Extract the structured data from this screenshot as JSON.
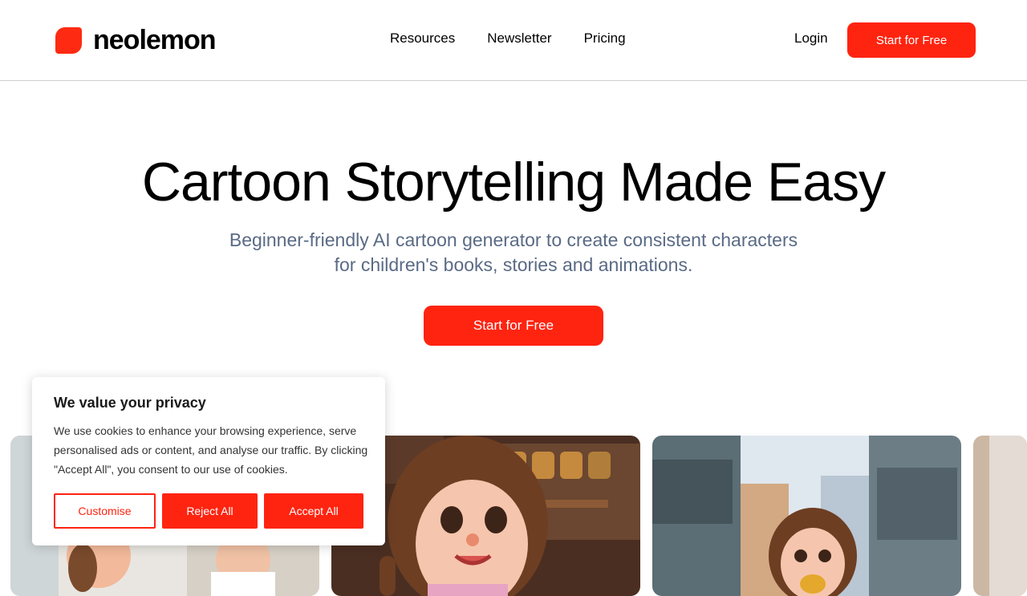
{
  "brand": {
    "name": "neolemon",
    "accent": "#ff2410"
  },
  "nav": {
    "items": [
      {
        "label": "Resources"
      },
      {
        "label": "Newsletter"
      },
      {
        "label": "Pricing"
      }
    ],
    "login_label": "Login",
    "cta_label": "Start for Free"
  },
  "hero": {
    "title": "Cartoon Storytelling Made Easy",
    "subtitle_line1": "Beginner-friendly AI cartoon generator to create consistent characters",
    "subtitle_line2": "for children's books, stories and animations.",
    "cta_label": "Start for Free"
  },
  "gallery": {
    "images": [
      {
        "icon": "cartoon-kitchen-scene-image"
      },
      {
        "icon": "cartoon-girl-shop-image"
      },
      {
        "icon": "cartoon-girl-street-image"
      },
      {
        "icon": "cartoon-partial-image"
      }
    ]
  },
  "cookie": {
    "title": "We value your privacy",
    "text": "We use cookies to enhance your browsing experience, serve personalised ads or content, and analyse our traffic. By clicking \"Accept All\", you consent to our use of cookies.",
    "customise_label": "Customise",
    "reject_label": "Reject All",
    "accept_label": "Accept All"
  }
}
